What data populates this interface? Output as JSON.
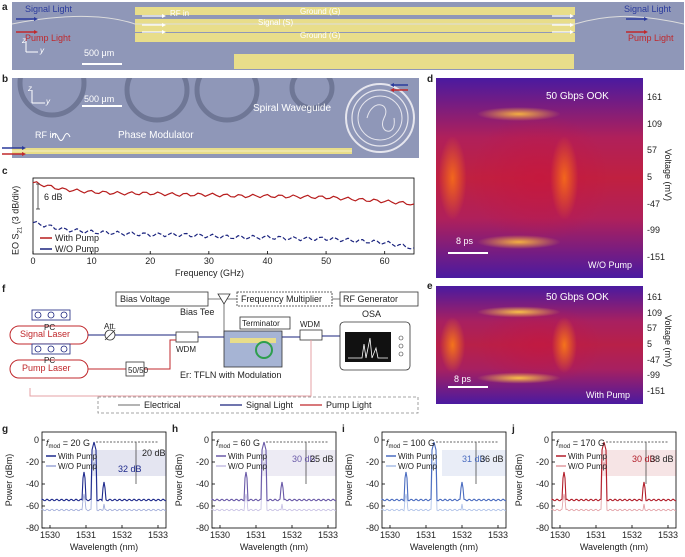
{
  "panel_labels": {
    "a": "a",
    "b": "b",
    "c": "c",
    "d": "d",
    "e": "e",
    "f": "f",
    "g": "g",
    "h": "h",
    "i": "i",
    "j": "j"
  },
  "panel_a": {
    "signal_light_left": "Signal Light",
    "pump_light_left": "Pump Light",
    "signal_light_right": "Signal Light",
    "pump_light_right": "Pump Light",
    "rf_in": "RF in",
    "signal": "Signal (S)",
    "ground_top": "Ground (G)",
    "ground_bottom": "Ground (G)",
    "scale": "500 μm",
    "axis_z": "z",
    "axis_y": "y"
  },
  "panel_b": {
    "axis_z": "z",
    "axis_y": "y",
    "scale": "500 μm",
    "spiral": "Spiral Waveguide",
    "rf_in": "RF in",
    "phase_modulator": "Phase Modulator"
  },
  "panel_c": {
    "ylabel": "EO S",
    "ylabel_sub": "21",
    "ylabel_unit": " (3 dB/div)",
    "xlabel": "Frequency (GHz)",
    "annotation": "6 dB",
    "legend_with": "With Pump",
    "legend_wo": "W/O Pump"
  },
  "panel_d": {
    "title": "50 Gbps OOK",
    "scale": "8 ps",
    "condition": "W/O Pump",
    "ylabel": "Voltage (mV)"
  },
  "panel_e": {
    "title": "50 Gbps OOK",
    "scale": "8 ps",
    "condition": "With Pump",
    "ylabel": "Voltage (mV)"
  },
  "eye_ticks": [
    "161",
    "109",
    "57",
    "5",
    "-47",
    "-99",
    "-151"
  ],
  "panel_f": {
    "bias_voltage": "Bias Voltage",
    "freq_mult": "Frequency Multiplier",
    "rf_gen": "RF Generator",
    "bias_tee": "Bias Tee",
    "terminator": "Terminator",
    "osa": "OSA",
    "signal_laser": "Signal Laser",
    "pump_laser": "Pump Laser",
    "pc1": "PC",
    "pc2": "PC",
    "att": "Att.",
    "wdm1": "WDM",
    "wdm2": "WDM",
    "splitter": "50/50",
    "device": "Er: TFLN with Modulation",
    "legend_electrical": "Electrical",
    "legend_signal": "Signal Light",
    "legend_pump": "Pump Light"
  },
  "spectra": [
    {
      "fmod": "= 20 G",
      "ann1": "20 dB",
      "ann2": "32 dB",
      "xticks": [
        "1530",
        "1531",
        "1532",
        "1533"
      ],
      "color": "#1e2a8c",
      "light": "#9aa6d6"
    },
    {
      "fmod": "= 60 G",
      "ann1": "30 dB",
      "ann2": "25 dB",
      "xticks": [
        "1530",
        "1531",
        "1532",
        "1533"
      ],
      "color": "#6a5aa8",
      "light": "#c4bde2"
    },
    {
      "fmod": "= 100 G",
      "ann1": "31 dB",
      "ann2": "36 dB",
      "xticks": [
        "1530",
        "1531",
        "1532",
        "1533"
      ],
      "color": "#4a6cc0",
      "light": "#a9bde6"
    },
    {
      "fmod": "= 170 G",
      "ann1": "30 dB",
      "ann2": "38 dB",
      "xticks": [
        "1530",
        "1531",
        "1532",
        "1533"
      ],
      "color": "#b21e2a",
      "light": "#e09aa0"
    }
  ],
  "spectra_common": {
    "ylabel": "Power (dBm)",
    "xlabel": "Wavelength (nm)",
    "fmod_label": "f",
    "fmod_sub": "mod",
    "legend_with": "With Pump",
    "legend_wo": "W/O Pump",
    "yticks": [
      "0",
      "-20",
      "-40",
      "-60",
      "-80"
    ]
  },
  "chart_data": [
    {
      "type": "line",
      "xlabel": "Frequency (GHz)",
      "ylabel": "EO S21 (3 dB/div)",
      "xlim": [
        0,
        65
      ],
      "x_ticks": [
        0,
        10,
        20,
        30,
        40,
        50,
        60
      ],
      "series": [
        {
          "name": "With Pump",
          "x": [
            0,
            5,
            10,
            15,
            20,
            25,
            30,
            35,
            40,
            45,
            50,
            55,
            60,
            65
          ],
          "y": [
            0.2,
            -0.8,
            -1.2,
            -1.4,
            -1.4,
            -1.6,
            -1.6,
            -1.8,
            -1.8,
            -1.9,
            -2.0,
            -2.3,
            -2.6,
            -3.0
          ]
        },
        {
          "name": "W/O Pump",
          "x": [
            0,
            5,
            10,
            15,
            20,
            25,
            30,
            35,
            40,
            45,
            50,
            55,
            60,
            65
          ],
          "y": [
            -5.8,
            -6.8,
            -7.2,
            -7.4,
            -7.6,
            -7.6,
            -7.8,
            -8.0,
            -8.0,
            -8.2,
            -8.2,
            -8.5,
            -8.8,
            -9.6
          ]
        }
      ]
    },
    {
      "type": "heatmap",
      "title": "50 Gbps OOK (W/O Pump)",
      "ylabel": "Voltage (mV)",
      "y_ticks": [
        161,
        109,
        57,
        5,
        -47,
        -99,
        -151
      ]
    },
    {
      "type": "heatmap",
      "title": "50 Gbps OOK (With Pump)",
      "ylabel": "Voltage (mV)",
      "y_ticks": [
        161,
        109,
        57,
        5,
        -47,
        -99,
        -151
      ]
    }
  ]
}
